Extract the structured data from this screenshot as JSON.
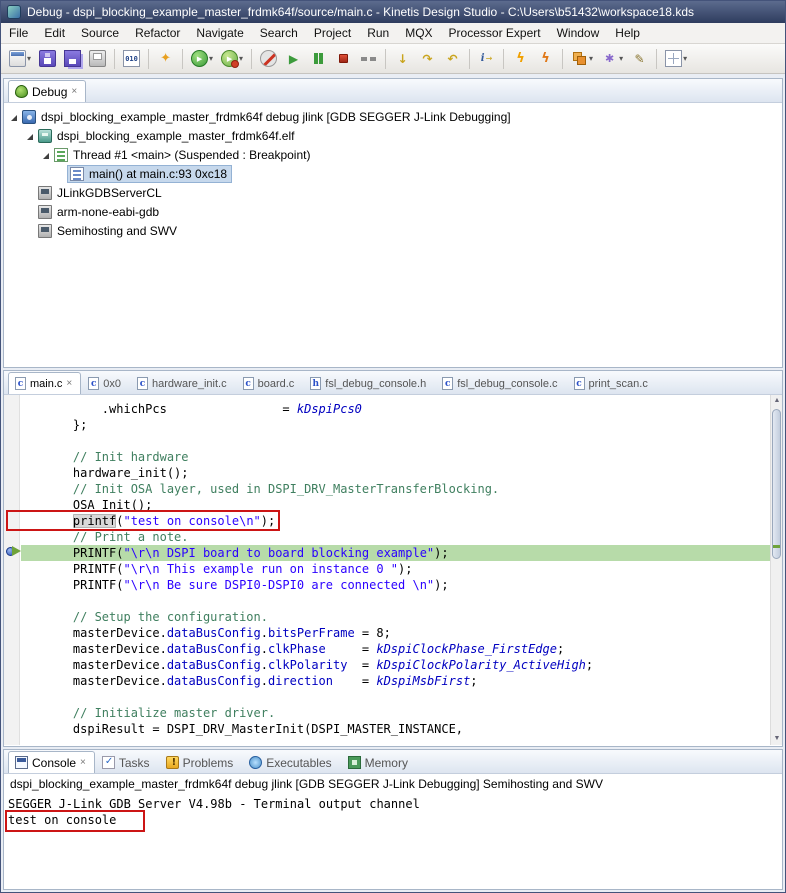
{
  "window": {
    "title": "Debug - dspi_blocking_example_master_frdmk64f/source/main.c - Kinetis Design Studio - C:\\Users\\b51432\\workspace18.kds"
  },
  "icons": {
    "close": "×",
    "dropdown": "▾"
  },
  "colors": {
    "annotation_red": "#cc1515",
    "exec_line_green": "#b7dba9",
    "selection_blue": "#c6d8ec"
  },
  "menu": {
    "items": [
      "File",
      "Edit",
      "Source",
      "Refactor",
      "Navigate",
      "Search",
      "Project",
      "Run",
      "MQX",
      "Processor Expert",
      "Window",
      "Help"
    ]
  },
  "toolbar": {
    "buttons": [
      {
        "name": "new",
        "glyph": "new",
        "dropdown": true
      },
      {
        "name": "save",
        "glyph": "save"
      },
      {
        "name": "save-all",
        "glyph": "saveall"
      },
      {
        "name": "print",
        "glyph": "print"
      },
      {
        "sep": true
      },
      {
        "name": "binary-console",
        "glyph": "binary"
      },
      {
        "sep": true
      },
      {
        "name": "processor-expert",
        "glyph": "sparkle"
      },
      {
        "sep": true
      },
      {
        "name": "debug",
        "glyph": "debug",
        "dropdown": true
      },
      {
        "name": "run",
        "glyph": "run",
        "dropdown": true
      },
      {
        "sep": true
      },
      {
        "name": "skip-all-breakpoints",
        "glyph": "skipbp"
      },
      {
        "name": "resume",
        "glyph": "resume"
      },
      {
        "name": "suspend",
        "glyph": "pause"
      },
      {
        "name": "terminate",
        "glyph": "stop"
      },
      {
        "name": "disconnect",
        "glyph": "disconnect"
      },
      {
        "sep": true
      },
      {
        "name": "step-into",
        "glyph": "stepinto"
      },
      {
        "name": "step-over",
        "glyph": "stepover"
      },
      {
        "name": "step-return",
        "glyph": "stepreturn"
      },
      {
        "sep": true
      },
      {
        "name": "instruction-stepping",
        "glyph": "insstep"
      },
      {
        "sep": true
      },
      {
        "name": "flash-programmer",
        "glyph": "flash"
      },
      {
        "name": "flash-from-file",
        "glyph": "flash2"
      },
      {
        "sep": true
      },
      {
        "name": "open-packages",
        "glyph": "packages",
        "dropdown": true
      },
      {
        "name": "new-wizard",
        "glyph": "wand",
        "dropdown": true
      },
      {
        "name": "annotate",
        "glyph": "pencil"
      },
      {
        "sep": true
      },
      {
        "name": "open-perspective",
        "glyph": "grid",
        "dropdown": true
      }
    ]
  },
  "debug_panel": {
    "tab_label": "Debug",
    "tree": [
      {
        "level": 0,
        "icon": "launch",
        "expanded": true,
        "label": "dspi_blocking_example_master_frdmk64f debug jlink [GDB SEGGER J-Link Debugging]"
      },
      {
        "level": 1,
        "icon": "program",
        "expanded": true,
        "label": "dspi_blocking_example_master_frdmk64f.elf"
      },
      {
        "level": 2,
        "icon": "thread",
        "expanded": true,
        "label": "Thread #1 <main> (Suspended : Breakpoint)"
      },
      {
        "level": 3,
        "icon": "frame",
        "selected": true,
        "label": "main() at main.c:93 0xc18"
      },
      {
        "level": 1,
        "icon": "process",
        "label": "JLinkGDBServerCL"
      },
      {
        "level": 1,
        "icon": "process",
        "label": "arm-none-eabi-gdb"
      },
      {
        "level": 1,
        "icon": "process",
        "label": "Semihosting and SWV"
      }
    ]
  },
  "editor": {
    "tabs": [
      {
        "label": "main.c",
        "icon": "c",
        "active": true
      },
      {
        "label": "0x0",
        "icon": "c"
      },
      {
        "label": "hardware_init.c",
        "icon": "c"
      },
      {
        "label": "board.c",
        "icon": "c"
      },
      {
        "label": "fsl_debug_console.h",
        "icon": "h"
      },
      {
        "label": "fsl_debug_console.c",
        "icon": "c"
      },
      {
        "label": "print_scan.c",
        "icon": "c"
      }
    ],
    "code_lines": [
      {
        "t": [
          [
            "plain",
            "        .whichPcs                = "
          ],
          [
            "const",
            "kDspiPcs0"
          ]
        ]
      },
      {
        "t": [
          [
            "plain",
            "    };"
          ]
        ]
      },
      {
        "t": []
      },
      {
        "t": [
          [
            "comment",
            "    // Init hardware"
          ]
        ]
      },
      {
        "t": [
          [
            "plain",
            "    hardware_init();"
          ]
        ]
      },
      {
        "t": [
          [
            "comment",
            "    // Init OSA layer, used in DSPI_DRV_MasterTransferBlocking."
          ]
        ]
      },
      {
        "t": [
          [
            "plain",
            "    OSA_Init();"
          ]
        ]
      },
      {
        "t": [
          [
            "plain",
            "    "
          ],
          [
            "occ",
            "printf"
          ],
          [
            "plain",
            "("
          ],
          [
            "string",
            "\"test on console\\n\""
          ],
          [
            "plain",
            ");"
          ]
        ]
      },
      {
        "t": [
          [
            "comment",
            "    // Print a note."
          ]
        ]
      },
      {
        "t": [
          [
            "plain",
            "    PRINTF("
          ],
          [
            "string",
            "\"\\r\\n DSPI board to board blocking example\""
          ],
          [
            "plain",
            ");"
          ]
        ],
        "hl": "exec"
      },
      {
        "t": [
          [
            "plain",
            "    PRINTF("
          ],
          [
            "string",
            "\"\\r\\n This example run on instance 0 \""
          ],
          [
            "plain",
            ");"
          ]
        ]
      },
      {
        "t": [
          [
            "plain",
            "    PRINTF("
          ],
          [
            "string",
            "\"\\r\\n Be sure DSPI0-DSPI0 are connected \\n\""
          ],
          [
            "plain",
            ");"
          ]
        ]
      },
      {
        "t": []
      },
      {
        "t": [
          [
            "comment",
            "    // Setup the configuration."
          ]
        ]
      },
      {
        "t": [
          [
            "plain",
            "    masterDevice."
          ],
          [
            "member",
            "dataBusConfig"
          ],
          [
            "plain",
            "."
          ],
          [
            "member",
            "bitsPerFrame"
          ],
          [
            "plain",
            " = 8;"
          ]
        ]
      },
      {
        "t": [
          [
            "plain",
            "    masterDevice."
          ],
          [
            "member",
            "dataBusConfig"
          ],
          [
            "plain",
            "."
          ],
          [
            "member",
            "clkPhase"
          ],
          [
            "plain",
            "     = "
          ],
          [
            "const",
            "kDspiClockPhase_FirstEdge"
          ],
          [
            "plain",
            ";"
          ]
        ]
      },
      {
        "t": [
          [
            "plain",
            "    masterDevice."
          ],
          [
            "member",
            "dataBusConfig"
          ],
          [
            "plain",
            "."
          ],
          [
            "member",
            "clkPolarity"
          ],
          [
            "plain",
            "  = "
          ],
          [
            "const",
            "kDspiClockPolarity_ActiveHigh"
          ],
          [
            "plain",
            ";"
          ]
        ]
      },
      {
        "t": [
          [
            "plain",
            "    masterDevice."
          ],
          [
            "member",
            "dataBusConfig"
          ],
          [
            "plain",
            "."
          ],
          [
            "member",
            "direction"
          ],
          [
            "plain",
            "    = "
          ],
          [
            "const",
            "kDspiMsbFirst"
          ],
          [
            "plain",
            ";"
          ]
        ]
      },
      {
        "t": []
      },
      {
        "t": [
          [
            "comment",
            "    // Initialize master driver."
          ]
        ]
      },
      {
        "t": [
          [
            "plain",
            "    dspiResult = DSPI_DRV_MasterInit(DSPI_MASTER_INSTANCE,"
          ]
        ]
      }
    ]
  },
  "console_panel": {
    "tabs": [
      {
        "label": "Console",
        "icon": "console",
        "active": true
      },
      {
        "label": "Tasks",
        "icon": "tasks"
      },
      {
        "label": "Problems",
        "icon": "problems"
      },
      {
        "label": "Executables",
        "icon": "executables"
      },
      {
        "label": "Memory",
        "icon": "memory"
      }
    ],
    "header": "dspi_blocking_example_master_frdmk64f debug jlink [GDB SEGGER J-Link Debugging] Semihosting and SWV",
    "lines": [
      {
        "text": "SEGGER J-Link GDB Server V4.98b - Terminal output channel"
      },
      {
        "text": "test on console",
        "boxed": true
      }
    ]
  }
}
